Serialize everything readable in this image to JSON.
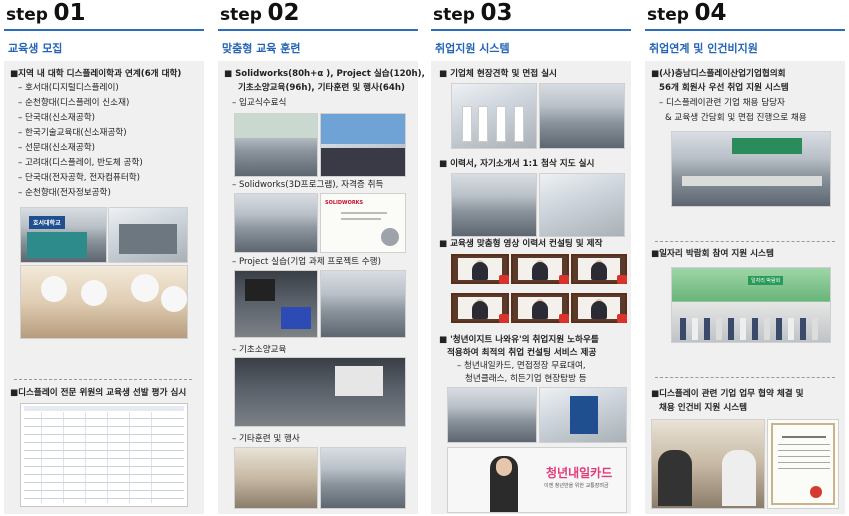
{
  "columns": [
    {
      "step_word": "step",
      "step_num": "01",
      "title": "교육생 모집",
      "bullet1": "■지역 내 대학 디스플레이학과 연계(6개 대학)",
      "subs": [
        "– 호서대(디지털디스플레이)",
        "– 순천향대(디스플레이 신소재)",
        "– 단국대(신소재공학)",
        "– 한국기술교육대(신소재공학)",
        "– 선문대(신소재공학)",
        "– 고려대(디스플레이, 반도체 공학)",
        "– 단국대(전자공학, 전자컴퓨터학)",
        "– 순천향대(전자정보공학)"
      ],
      "photo_sign": "호서대학교",
      "bullet2": "■디스플레이 전문 위원의 교육생 선발 평가 심시"
    },
    {
      "step_word": "step",
      "step_num": "02",
      "title": "맞춤형 교육 훈련",
      "bullet1_l1": "■ Solidworks(80h+α ), Project 실습(120h),",
      "bullet1_l2": "기초소양교육(96h), 기타훈련 및 행사(64h)",
      "sub1": "– 입교식수료식",
      "sub2": "– Solidworks(3D프로그램), 자격증 취득",
      "sub3": "– Project 실습(기업 과제 프로젝트 수행)",
      "sub4": "– 기초소양교육",
      "sub5": "– 기타훈련 및 행사",
      "cert_brand": "SOLIDWORKS"
    },
    {
      "step_word": "step",
      "step_num": "03",
      "title": "취업지원 시스템",
      "bullet1": "■ 기업체 현장견학 및 면접 실시",
      "bullet2": "■ 이력서, 자기소개서 1:1 첨삭 지도 실시",
      "bullet3": "■ 교육생 맞춤형 영상 이력서 컨설팅 및 제작",
      "bullet4_l1": "■ '청년이지트 나와유'의 취업지원 노하우를",
      "bullet4_l2": "적용하여 최적의 취업 컨설팅 서비스 제공",
      "bullet4_l3": "– 청년내일카드, 면접정장 무료대여,",
      "bullet4_l4": "청년클래스, 히든기업 현장탐방 등",
      "banner_title": "청년내일카드",
      "banner_sub": "이젠 청년만을 위한 교통장려금"
    },
    {
      "step_word": "step",
      "step_num": "04",
      "title": "취업연계 및 인건비지원",
      "bullet1_l1": "■(사)충남디스플레이산업기업협의회",
      "bullet1_l2": "56개 회원사 우선 취업 지원 시스템",
      "bullet1_l3": "– 디스플레이관련 기업 채용 담당자",
      "bullet1_l4": "& 교육생 간담회 및 면접 진행으로 채용",
      "bullet2": "■일자리 박람회 참여 지원 시스템",
      "fair_sign": "일자리 박람회",
      "bullet3_l1": "■디스플레이 관련 기업 업무 협약 체결 및",
      "bullet3_l2": "채용 인건비 지원 시스템"
    }
  ],
  "colors": {
    "accent": "#2c6cb8",
    "title_blue": "#2565b5",
    "panel_bg": "#f0f0f0"
  }
}
